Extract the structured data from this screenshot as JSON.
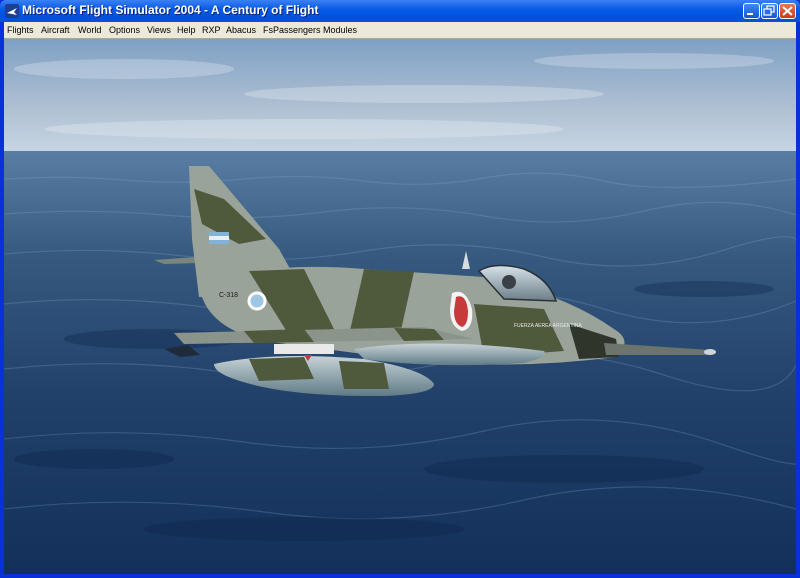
{
  "window": {
    "title": "Microsoft Flight Simulator 2004 - A Century of Flight",
    "controls": [
      "minimize",
      "restore",
      "close"
    ]
  },
  "menubar": {
    "items": [
      {
        "label": "Flights"
      },
      {
        "label": "Aircraft"
      },
      {
        "label": "World"
      },
      {
        "label": "Options"
      },
      {
        "label": "Views"
      },
      {
        "label": "Help"
      },
      {
        "label": "RXP"
      },
      {
        "label": "Abacus"
      },
      {
        "label": "FsPassengers"
      },
      {
        "label": "Modules"
      }
    ]
  },
  "scene": {
    "aircraft_serial": "C-318",
    "fuselage_text": "FUERZA AEREA ARGENTINA",
    "colors": {
      "sky_top": "#7fa0c4",
      "sky_bottom": "#c6d5e3",
      "sea_far": "#4a6f96",
      "sea_near": "#12305a",
      "camo_light": "#9aa39a",
      "camo_dark": "#4f5a3c"
    }
  }
}
